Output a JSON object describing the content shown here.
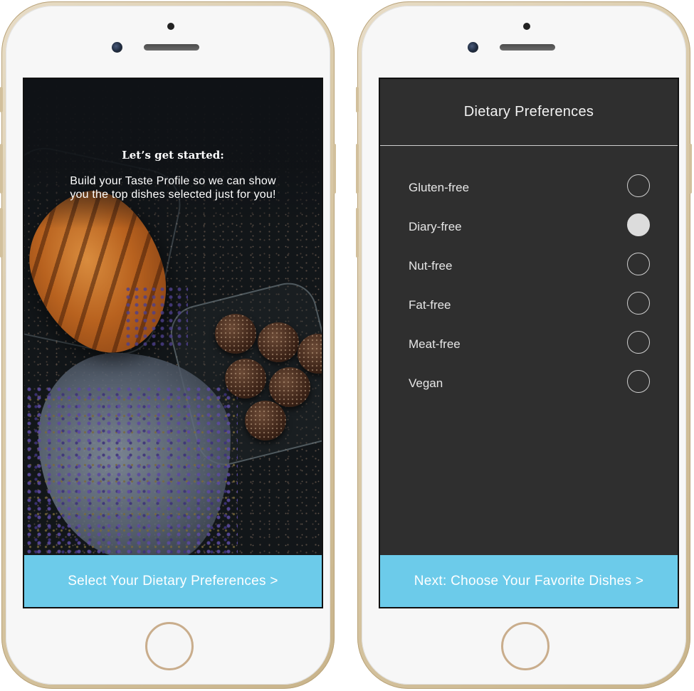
{
  "left_screen": {
    "intro_title": "Let’s get started:",
    "intro_body": "Build your Taste Profile so we can show you the top dishes selected just for you!",
    "cta_label": "Select Your Dietary Preferences >"
  },
  "right_screen": {
    "title": "Dietary Preferences",
    "preferences": [
      {
        "label": "Gluten-free",
        "selected": false
      },
      {
        "label": "Diary-free",
        "selected": true
      },
      {
        "label": "Nut-free",
        "selected": false
      },
      {
        "label": "Fat-free",
        "selected": false
      },
      {
        "label": "Meat-free",
        "selected": false
      },
      {
        "label": "Vegan",
        "selected": false
      }
    ],
    "cta_label": "Next: Choose Your Favorite Dishes >"
  },
  "colors": {
    "accent": "#6ccbea",
    "right_background": "#2f2f2f",
    "phone_frame": "#d9c9a7"
  }
}
